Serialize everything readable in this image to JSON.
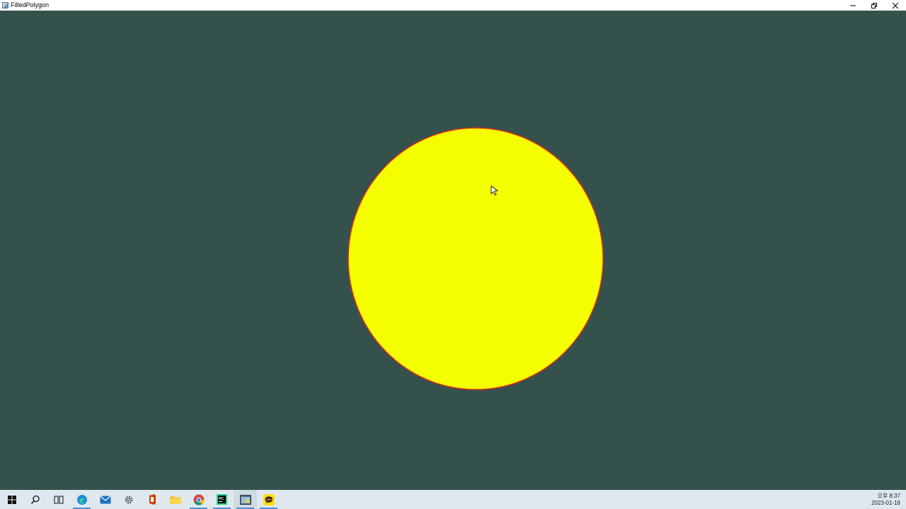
{
  "window": {
    "title": "FilledPolygon",
    "background_color": "#35514c"
  },
  "shape": {
    "fill_color": "#f5ff00",
    "stroke_color": "#e0301a"
  },
  "taskbar": {
    "items": [
      {
        "icon": "windows-start-icon"
      },
      {
        "icon": "search-icon"
      },
      {
        "icon": "task-view-icon"
      },
      {
        "icon": "edge-browser-icon"
      },
      {
        "icon": "mail-icon"
      },
      {
        "icon": "settings-gear-icon"
      },
      {
        "icon": "office-icon"
      },
      {
        "icon": "file-explorer-icon"
      },
      {
        "icon": "chrome-icon"
      },
      {
        "icon": "pycharm-icon"
      },
      {
        "icon": "python-app-icon"
      },
      {
        "icon": "kakaotalk-icon"
      }
    ],
    "clock": {
      "time": "오후 8:37",
      "date": "2023-01-18"
    }
  }
}
